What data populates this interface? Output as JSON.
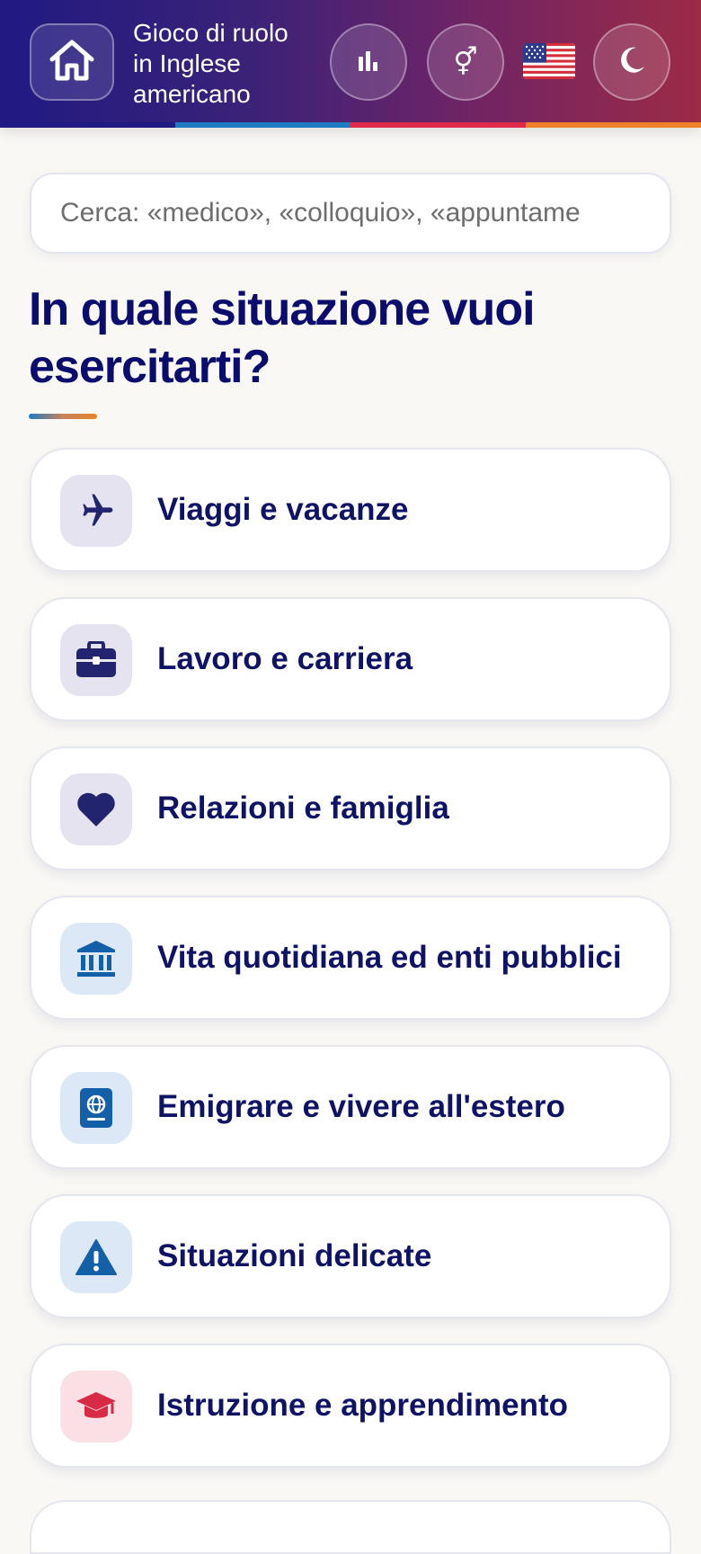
{
  "header": {
    "title": "Gioco di ruolo\nin Inglese\namericano",
    "home_icon": "home-icon",
    "stats_icon": "bar-chart-icon",
    "gender_icon": "gender-symbol-icon",
    "gender_glyph": "⚥",
    "flag_icon": "us-flag-icon",
    "theme_icon": "moon-icon",
    "stripe_colors": [
      "#201a82",
      "#1f7bc1",
      "#e0294a",
      "#ee8129"
    ]
  },
  "search": {
    "placeholder": "Cerca: «medico», «colloquio», «appuntame",
    "value": ""
  },
  "main": {
    "heading": "In quale situazione vuoi esercitarti?"
  },
  "categories": [
    {
      "label": "Viaggi e vacanze",
      "icon": "airplane-icon",
      "icon_bg": "#e4e3ef",
      "icon_color": "#23246f"
    },
    {
      "label": "Lavoro e carriera",
      "icon": "briefcase-icon",
      "icon_bg": "#e4e3ef",
      "icon_color": "#23246f"
    },
    {
      "label": "Relazioni e famiglia",
      "icon": "heart-icon",
      "icon_bg": "#e4e3ef",
      "icon_color": "#23246f"
    },
    {
      "label": "Vita quotidiana ed enti pubblici",
      "icon": "government-building-icon",
      "icon_bg": "#dce8f5",
      "icon_color": "#1460a8"
    },
    {
      "label": "Emigrare e vivere all'estero",
      "icon": "passport-icon",
      "icon_bg": "#dce8f5",
      "icon_color": "#1460a8"
    },
    {
      "label": "Situazioni delicate",
      "icon": "warning-icon",
      "icon_bg": "#dce8f5",
      "icon_color": "#1460a8"
    },
    {
      "label": "Istruzione e apprendimento",
      "icon": "graduation-cap-icon",
      "icon_bg": "#fadfe4",
      "icon_color": "#d62a45"
    }
  ]
}
